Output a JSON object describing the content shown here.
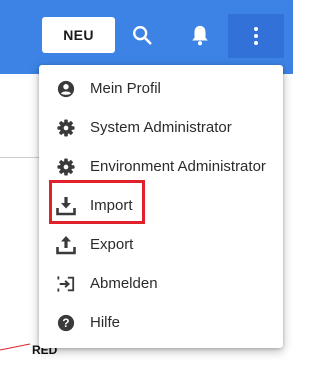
{
  "toolbar": {
    "new_label": "NEU",
    "search_icon": "search-icon",
    "notifications_icon": "bell-icon",
    "more_icon": "more-vertical-icon",
    "accent_color": "#3d83e5"
  },
  "menu": {
    "items": [
      {
        "label": "Mein Profil",
        "icon": "account-circle-icon"
      },
      {
        "label": "System Administrator",
        "icon": "gear-icon"
      },
      {
        "label": "Environment Administrator",
        "icon": "gear-icon"
      },
      {
        "label": "Import",
        "icon": "download-tray-icon"
      },
      {
        "label": "Export",
        "icon": "upload-tray-icon"
      },
      {
        "label": "Abmelden",
        "icon": "logout-icon"
      },
      {
        "label": "Hilfe",
        "icon": "help-circle-icon"
      }
    ],
    "highlighted_item": "Import",
    "highlight_color": "#e0202a"
  },
  "background": {
    "partial_text": "RED"
  }
}
